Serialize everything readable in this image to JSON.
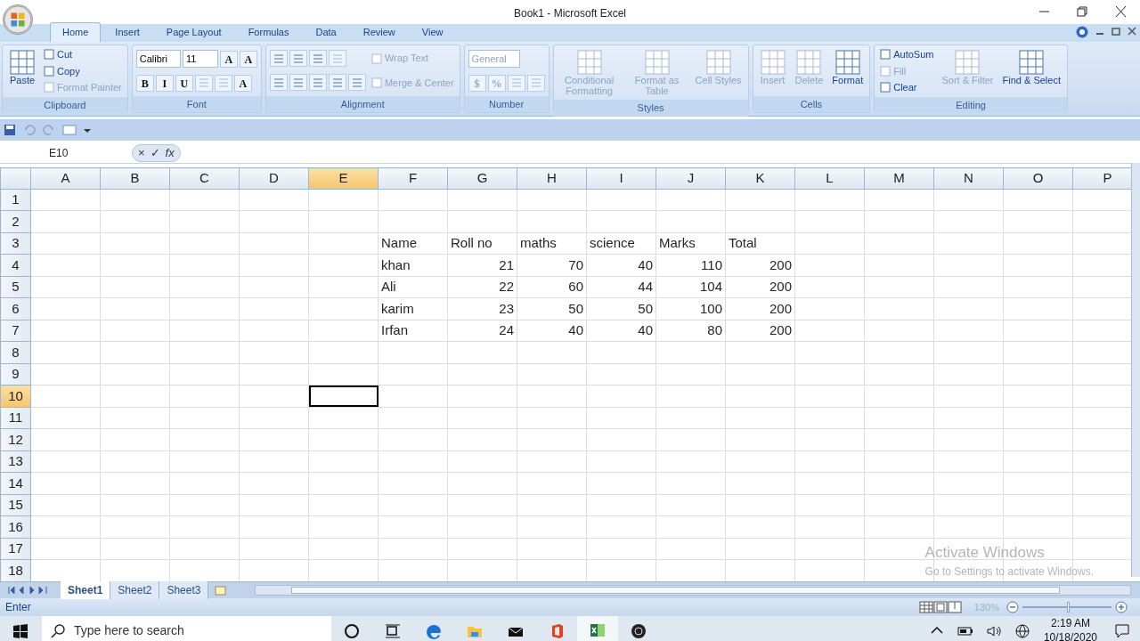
{
  "window": {
    "title": "Book1 - Microsoft Excel"
  },
  "ribbon_tabs": [
    {
      "label": "Home",
      "selected": true
    },
    {
      "label": "Insert",
      "selected": false
    },
    {
      "label": "Page Layout",
      "selected": false
    },
    {
      "label": "Formulas",
      "selected": false
    },
    {
      "label": "Data",
      "selected": false
    },
    {
      "label": "Review",
      "selected": false
    },
    {
      "label": "View",
      "selected": false
    }
  ],
  "ribbon_groups": [
    {
      "label": "Clipboard",
      "columns": [
        {
          "kind": "large",
          "text": "Paste",
          "disabled": false
        },
        {
          "kind": "stack",
          "lines": [
            {
              "controls": [
                {
                  "kind": "small",
                  "text": "Cut",
                  "disabled": false
                }
              ]
            },
            {
              "controls": [
                {
                  "kind": "small",
                  "text": "Copy",
                  "disabled": false
                }
              ]
            },
            {
              "controls": [
                {
                  "kind": "small",
                  "text": "Format Painter",
                  "disabled": true
                }
              ]
            }
          ]
        }
      ]
    },
    {
      "label": "Font",
      "columns": [
        {
          "kind": "stack",
          "lines": [
            {
              "controls": [
                {
                  "kind": "combo",
                  "text": "Calibri",
                  "disabled": false
                },
                {
                  "kind": "combo",
                  "text": "11",
                  "disabled": false
                },
                {
                  "kind": "glyph",
                  "text": "A",
                  "disabled": false
                },
                {
                  "kind": "glyph",
                  "text": "A",
                  "disabled": false
                }
              ]
            },
            {
              "controls": [
                {
                  "kind": "glyph",
                  "text": "B",
                  "disabled": false
                },
                {
                  "kind": "glyph",
                  "text": "I",
                  "disabled": false
                },
                {
                  "kind": "glyph",
                  "text": "U",
                  "disabled": false
                },
                {
                  "kind": "icon",
                  "disabled": true
                },
                {
                  "kind": "icon",
                  "disabled": true
                },
                {
                  "kind": "glyph",
                  "text": "A",
                  "disabled": false
                }
              ]
            }
          ]
        }
      ]
    },
    {
      "label": "Alignment",
      "columns": [
        {
          "kind": "stack",
          "lines": [
            {
              "controls": [
                {
                  "kind": "icon",
                  "disabled": false
                },
                {
                  "kind": "icon",
                  "disabled": false
                },
                {
                  "kind": "icon",
                  "disabled": false
                },
                {
                  "kind": "icon",
                  "disabled": true
                }
              ]
            },
            {
              "controls": [
                {
                  "kind": "icon",
                  "disabled": false
                },
                {
                  "kind": "icon",
                  "disabled": false
                },
                {
                  "kind": "icon",
                  "disabled": false
                },
                {
                  "kind": "icon",
                  "disabled": false
                },
                {
                  "kind": "icon",
                  "disabled": false
                }
              ]
            }
          ]
        },
        {
          "kind": "stack",
          "lines": [
            {
              "controls": [
                {
                  "kind": "small",
                  "text": "Wrap Text",
                  "disabled": true
                }
              ]
            },
            {
              "controls": [
                {
                  "kind": "small",
                  "text": "Merge & Center",
                  "disabled": true
                }
              ]
            }
          ]
        }
      ]
    },
    {
      "label": "Number",
      "columns": [
        {
          "kind": "stack",
          "lines": [
            {
              "controls": [
                {
                  "kind": "combo",
                  "text": "General",
                  "disabled": true
                }
              ]
            },
            {
              "controls": [
                {
                  "kind": "glyph",
                  "text": "$",
                  "disabled": true
                },
                {
                  "kind": "glyph",
                  "text": "%",
                  "disabled": true
                },
                {
                  "kind": "icon",
                  "disabled": true
                },
                {
                  "kind": "icon",
                  "disabled": true
                }
              ]
            }
          ]
        }
      ]
    },
    {
      "label": "Styles",
      "columns": [
        {
          "kind": "large",
          "text": "Conditional Formatting",
          "disabled": true
        },
        {
          "kind": "large",
          "text": "Format as Table",
          "disabled": true
        },
        {
          "kind": "large",
          "text": "Cell Styles",
          "disabled": true
        }
      ]
    },
    {
      "label": "Cells",
      "columns": [
        {
          "kind": "large",
          "text": "Insert",
          "disabled": true
        },
        {
          "kind": "large",
          "text": "Delete",
          "disabled": true
        },
        {
          "kind": "large",
          "text": "Format",
          "disabled": false
        }
      ]
    },
    {
      "label": "Editing",
      "columns": [
        {
          "kind": "stack",
          "lines": [
            {
              "controls": [
                {
                  "kind": "small",
                  "text": "AutoSum",
                  "disabled": false
                }
              ]
            },
            {
              "controls": [
                {
                  "kind": "small",
                  "text": "Fill",
                  "disabled": true
                }
              ]
            },
            {
              "controls": [
                {
                  "kind": "small",
                  "text": "Clear",
                  "disabled": false
                }
              ]
            }
          ]
        },
        {
          "kind": "large",
          "text": "Sort & Filter",
          "disabled": true
        },
        {
          "kind": "large",
          "text": "Find & Select",
          "disabled": false
        }
      ]
    }
  ],
  "formula_bar": {
    "name_box": "E10",
    "buttons": [
      "×",
      "✓",
      "fx"
    ]
  },
  "columns": [
    {
      "label": "A",
      "selected": false
    },
    {
      "label": "B",
      "selected": false
    },
    {
      "label": "C",
      "selected": false
    },
    {
      "label": "D",
      "selected": false
    },
    {
      "label": "E",
      "selected": true
    },
    {
      "label": "F",
      "selected": false
    },
    {
      "label": "G",
      "selected": false
    },
    {
      "label": "H",
      "selected": false
    },
    {
      "label": "I",
      "selected": false
    },
    {
      "label": "J",
      "selected": false
    },
    {
      "label": "K",
      "selected": false
    },
    {
      "label": "L",
      "selected": false
    },
    {
      "label": "M",
      "selected": false
    },
    {
      "label": "N",
      "selected": false
    },
    {
      "label": "O",
      "selected": false
    },
    {
      "label": "P",
      "selected": false
    }
  ],
  "rows": [
    {
      "label": "1",
      "selected": false,
      "cells": []
    },
    {
      "label": "2",
      "selected": false,
      "cells": []
    },
    {
      "label": "3",
      "selected": false,
      "cells": [
        null,
        null,
        null,
        null,
        null,
        {
          "value": "Name",
          "kind": "text"
        },
        {
          "value": "Roll no",
          "kind": "text"
        },
        {
          "value": "maths",
          "kind": "text"
        },
        {
          "value": "science",
          "kind": "text"
        },
        {
          "value": "Marks",
          "kind": "text"
        },
        {
          "value": "Total",
          "kind": "text"
        }
      ]
    },
    {
      "label": "4",
      "selected": false,
      "cells": [
        null,
        null,
        null,
        null,
        null,
        {
          "value": "khan",
          "kind": "text"
        },
        {
          "value": "21",
          "kind": "number"
        },
        {
          "value": "70",
          "kind": "number"
        },
        {
          "value": "40",
          "kind": "number"
        },
        {
          "value": "110",
          "kind": "number"
        },
        {
          "value": "200",
          "kind": "number"
        }
      ]
    },
    {
      "label": "5",
      "selected": false,
      "cells": [
        null,
        null,
        null,
        null,
        null,
        {
          "value": "Ali",
          "kind": "text"
        },
        {
          "value": "22",
          "kind": "number"
        },
        {
          "value": "60",
          "kind": "number"
        },
        {
          "value": "44",
          "kind": "number"
        },
        {
          "value": "104",
          "kind": "number"
        },
        {
          "value": "200",
          "kind": "number"
        }
      ]
    },
    {
      "label": "6",
      "selected": false,
      "cells": [
        null,
        null,
        null,
        null,
        null,
        {
          "value": "karim",
          "kind": "text"
        },
        {
          "value": "23",
          "kind": "number"
        },
        {
          "value": "50",
          "kind": "number"
        },
        {
          "value": "50",
          "kind": "number"
        },
        {
          "value": "100",
          "kind": "number"
        },
        {
          "value": "200",
          "kind": "number"
        }
      ]
    },
    {
      "label": "7",
      "selected": false,
      "cells": [
        null,
        null,
        null,
        null,
        null,
        {
          "value": "Irfan",
          "kind": "text"
        },
        {
          "value": "24",
          "kind": "number"
        },
        {
          "value": "40",
          "kind": "number"
        },
        {
          "value": "40",
          "kind": "number"
        },
        {
          "value": "80",
          "kind": "number"
        },
        {
          "value": "200",
          "kind": "number"
        }
      ]
    },
    {
      "label": "8",
      "selected": false,
      "cells": []
    },
    {
      "label": "9",
      "selected": false,
      "cells": []
    },
    {
      "label": "10",
      "selected": true,
      "cells": []
    },
    {
      "label": "11",
      "selected": false,
      "cells": []
    },
    {
      "label": "12",
      "selected": false,
      "cells": []
    },
    {
      "label": "13",
      "selected": false,
      "cells": []
    },
    {
      "label": "14",
      "selected": false,
      "cells": []
    },
    {
      "label": "15",
      "selected": false,
      "cells": []
    },
    {
      "label": "16",
      "selected": false,
      "cells": []
    },
    {
      "label": "17",
      "selected": false,
      "cells": []
    },
    {
      "label": "18",
      "selected": false,
      "cells": []
    }
  ],
  "activation_notice": {
    "title": "Activate Windows",
    "text": "Go to Settings to activate Windows."
  },
  "sheet_tabs": [
    {
      "label": "Sheet1",
      "selected": true
    },
    {
      "label": "Sheet2",
      "selected": false
    },
    {
      "label": "Sheet3",
      "selected": false
    }
  ],
  "status_bar": {
    "mode": "Enter",
    "zoom": "130%",
    "zoom_level": {
      "level": 0.5
    }
  },
  "taskbar": {
    "search_placeholder": "Type here to search",
    "apps": [
      {
        "kind": "cortana",
        "selected": false
      },
      {
        "kind": "taskview",
        "selected": false
      },
      {
        "kind": "edge",
        "selected": false
      },
      {
        "kind": "explorer",
        "selected": false
      },
      {
        "kind": "mail",
        "selected": false
      },
      {
        "kind": "office",
        "selected": false
      },
      {
        "kind": "excel",
        "selected": true
      },
      {
        "kind": "obs",
        "selected": false
      }
    ],
    "time": "2:19 AM",
    "date": "10/18/2020"
  }
}
